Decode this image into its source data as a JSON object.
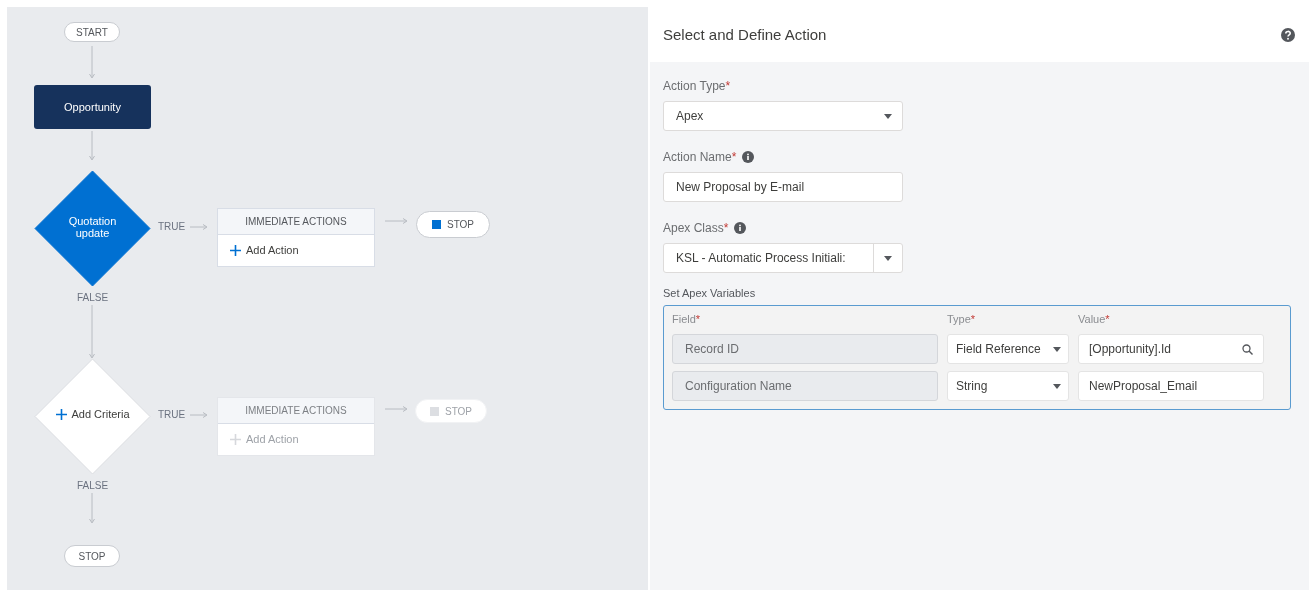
{
  "flow": {
    "start": "START",
    "object": "Opportunity",
    "criteria": [
      {
        "kind": "defined",
        "label": "Quotation update",
        "true_label": "TRUE",
        "false_label": "FALSE",
        "actions_header": "IMMEDIATE ACTIONS",
        "add_action": "Add Action",
        "disabled": false,
        "stop": "STOP"
      },
      {
        "kind": "placeholder",
        "label": "Add Criteria",
        "true_label": "TRUE",
        "false_label": "FALSE",
        "actions_header": "IMMEDIATE ACTIONS",
        "add_action": "Add Action",
        "disabled": true,
        "stop": "STOP"
      }
    ],
    "end": "STOP"
  },
  "panel": {
    "title": "Select and Define Action",
    "fields": [
      {
        "kind": "select",
        "label": "Action Type",
        "required_mark": "*",
        "info": false,
        "value": "Apex",
        "split": false
      },
      {
        "kind": "text",
        "label": "Action Name",
        "required_mark": "*",
        "info": true,
        "value": "New Proposal by E-mail"
      },
      {
        "kind": "select",
        "label": "Apex Class",
        "required_mark": "*",
        "info": true,
        "value": "KSL - Automatic Process Initiali:",
        "split": true
      }
    ],
    "variables": {
      "title": "Set Apex Variables",
      "columns": [
        {
          "label": "Field",
          "required_mark": "*"
        },
        {
          "label": "Type",
          "required_mark": "*"
        },
        {
          "label": "Value",
          "required_mark": "*"
        }
      ],
      "rows": [
        {
          "field": "Record ID",
          "type": "Field Reference",
          "value": "[Opportunity].Id",
          "lookup": true
        },
        {
          "field": "Configuration Name",
          "type": "String",
          "value": "NewProposal_Email",
          "lookup": false
        }
      ]
    }
  }
}
